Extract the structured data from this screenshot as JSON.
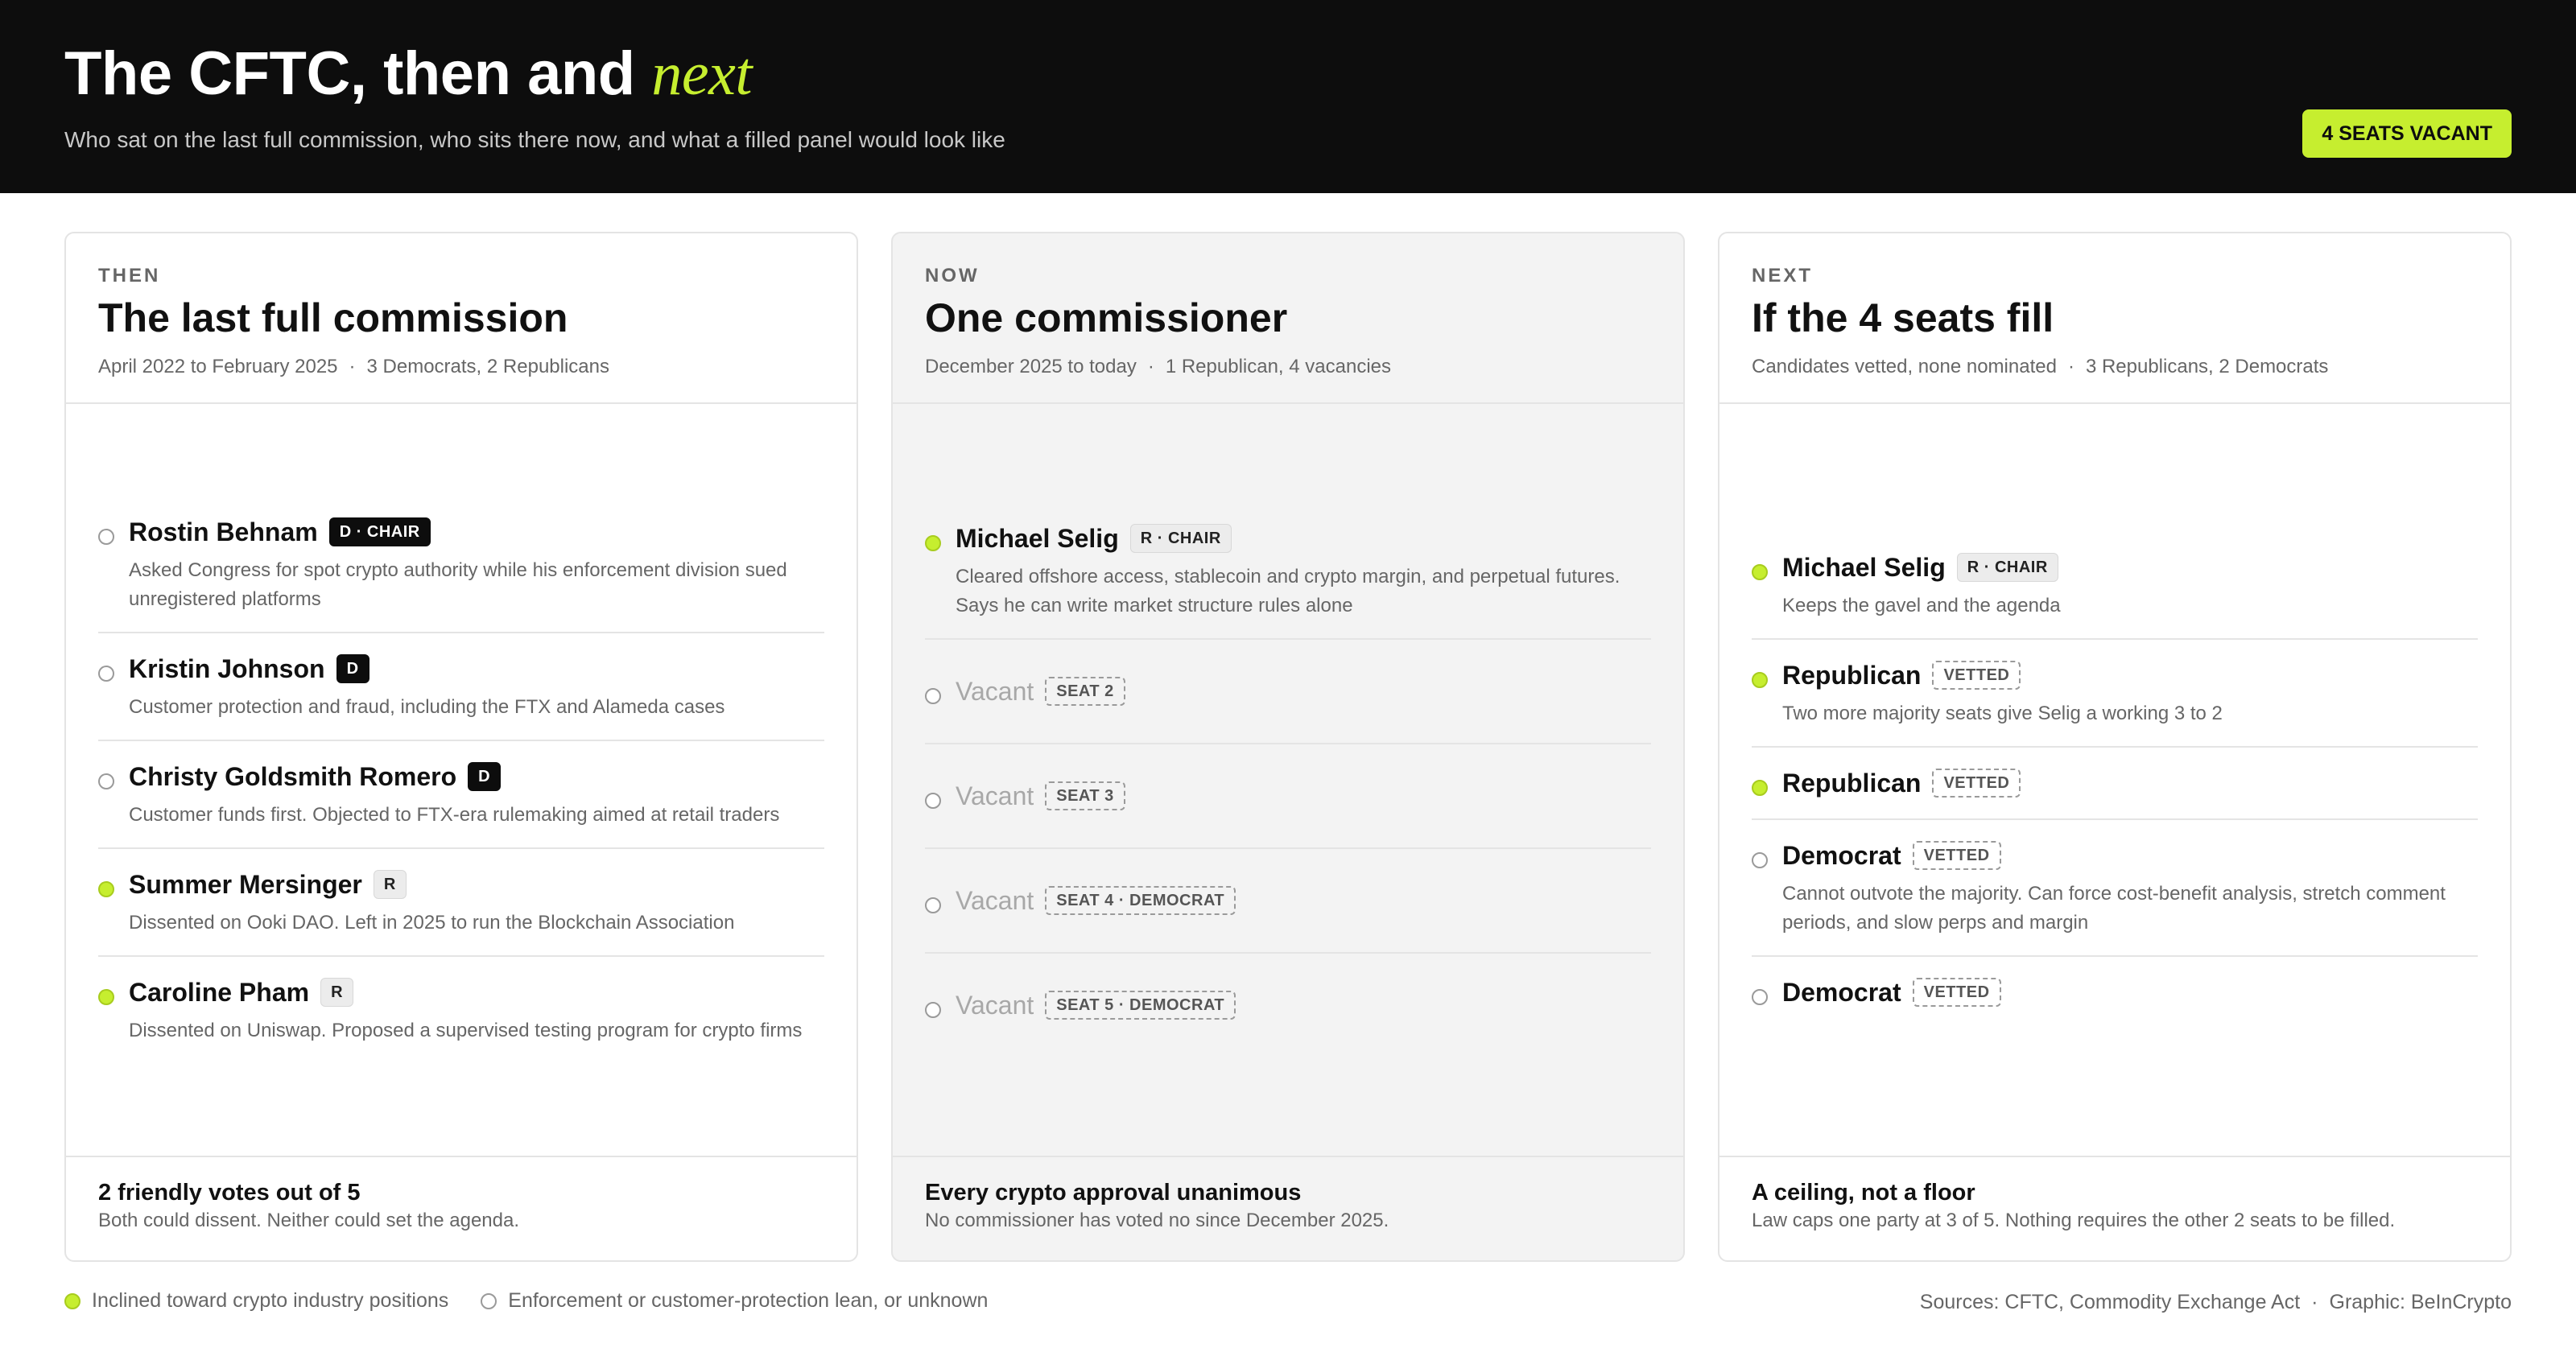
{
  "header": {
    "title_main": "The CFTC, then and ",
    "title_accent": "next",
    "subtitle": "Who sat on the last full commission, who sits there now, and what a filled panel would look like",
    "badge": "4 SEATS VACANT"
  },
  "colors": {
    "accent": "#c6ee2f",
    "header_bg": "#0d0d0d",
    "now_column_bg": "#f3f3f3"
  },
  "columns": [
    {
      "kicker": "THEN",
      "title": "The last full commission",
      "meta_dates": "April 2022 to February 2025",
      "meta_sep": "·",
      "meta_parties": "3 Democrats, 2 Republicans",
      "rows": [
        {
          "lean": "enforcement",
          "name": "Rostin Behnam",
          "tag": "D · CHAIR",
          "tag_style": "dark",
          "desc": "Asked Congress for spot crypto authority while his enforcement division sued unregistered platforms"
        },
        {
          "lean": "enforcement",
          "name": "Kristin Johnson",
          "tag": "D",
          "tag_style": "dark",
          "desc": "Customer protection and fraud, including the FTX and Alameda cases"
        },
        {
          "lean": "enforcement",
          "name": "Christy Goldsmith Romero",
          "tag": "D",
          "tag_style": "dark",
          "desc": "Customer funds first. Objected to FTX-era rulemaking aimed at retail traders"
        },
        {
          "lean": "crypto",
          "name": "Summer Mersinger",
          "tag": "R",
          "tag_style": "light",
          "desc": "Dissented on Ooki DAO. Left in 2025 to run the Blockchain Association"
        },
        {
          "lean": "crypto",
          "name": "Caroline Pham",
          "tag": "R",
          "tag_style": "light",
          "desc": "Dissented on Uniswap. Proposed a supervised testing program for crypto firms"
        }
      ],
      "foot_title": "2 friendly votes out of 5",
      "foot_text": "Both could dissent. Neither could set the agenda."
    },
    {
      "kicker": "NOW",
      "title": "One commissioner",
      "meta_dates": "December 2025 to today",
      "meta_sep": "·",
      "meta_parties": "1 Republican, 4 vacancies",
      "rows": [
        {
          "lean": "crypto",
          "name": "Michael Selig",
          "tag": "R · CHAIR",
          "tag_style": "light",
          "desc": "Cleared offshore access, stablecoin and crypto margin, and perpetual futures. Says he can write market structure rules alone"
        },
        {
          "lean": "unknown",
          "vacant": true,
          "name": "Vacant",
          "tag": "SEAT 2",
          "tag_style": "dashed",
          "desc": ""
        },
        {
          "lean": "unknown",
          "vacant": true,
          "name": "Vacant",
          "tag": "SEAT 3",
          "tag_style": "dashed",
          "desc": ""
        },
        {
          "lean": "unknown",
          "vacant": true,
          "name": "Vacant",
          "tag": "SEAT 4 · DEMOCRAT",
          "tag_style": "dashed",
          "desc": ""
        },
        {
          "lean": "unknown",
          "vacant": true,
          "name": "Vacant",
          "tag": "SEAT 5 · DEMOCRAT",
          "tag_style": "dashed",
          "desc": ""
        }
      ],
      "foot_title": "Every crypto approval unanimous",
      "foot_text": "No commissioner has voted no since December 2025."
    },
    {
      "kicker": "NEXT",
      "title": "If the 4 seats fill",
      "meta_dates": "Candidates vetted, none nominated",
      "meta_sep": "·",
      "meta_parties": "3 Republicans, 2 Democrats",
      "rows": [
        {
          "lean": "crypto",
          "name": "Michael Selig",
          "tag": "R · CHAIR",
          "tag_style": "light",
          "desc": "Keeps the gavel and the agenda"
        },
        {
          "lean": "crypto",
          "name": "Republican",
          "tag": "VETTED",
          "tag_style": "dashed",
          "desc": "Two more majority seats give Selig a working 3 to 2"
        },
        {
          "lean": "crypto",
          "name": "Republican",
          "tag": "VETTED",
          "tag_style": "dashed",
          "desc": ""
        },
        {
          "lean": "enforcement",
          "name": "Democrat",
          "tag": "VETTED",
          "tag_style": "dashed",
          "desc": "Cannot outvote the majority. Can force cost-benefit analysis, stretch comment periods, and slow perps and margin"
        },
        {
          "lean": "enforcement",
          "name": "Democrat",
          "tag": "VETTED",
          "tag_style": "dashed",
          "desc": ""
        }
      ],
      "foot_title": "A ceiling, not a floor",
      "foot_text": "Law caps one party at 3 of 5. Nothing requires the other 2 seats to be filled."
    }
  ],
  "legend": {
    "crypto_label": "Inclined toward crypto industry positions",
    "enforcement_label": "Enforcement or customer-protection lean, or unknown"
  },
  "sources": {
    "sources_text": "Sources: CFTC, Commodity Exchange Act",
    "sep": "·",
    "graphic_text": "Graphic: BeInCrypto"
  }
}
